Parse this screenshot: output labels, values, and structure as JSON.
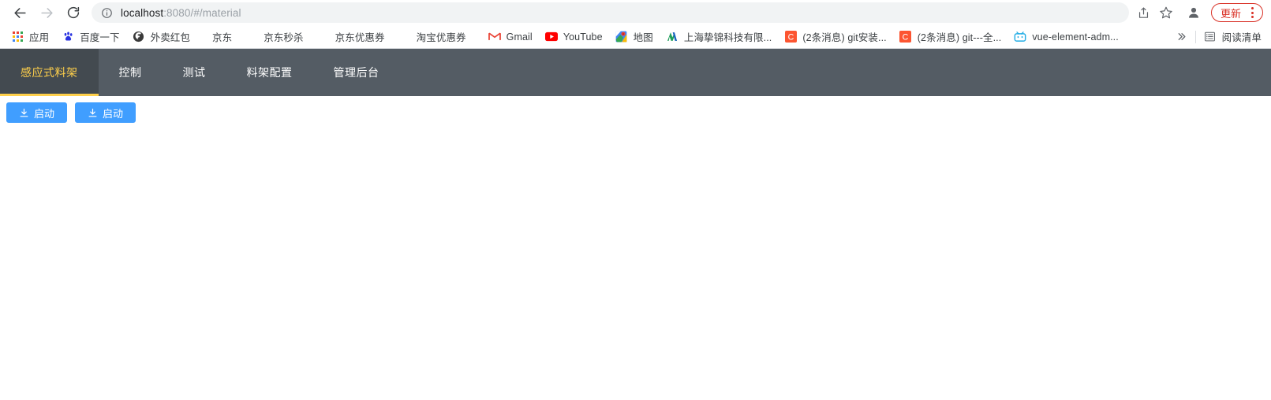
{
  "browser": {
    "nav": {
      "back_label": "Back",
      "forward_label": "Forward",
      "reload_label": "Reload"
    },
    "omnibox": {
      "site_info_icon": "info-circle-icon",
      "url_host": "localhost",
      "url_path": ":8080/#/material",
      "full_url": "localhost:8080/#/material",
      "share_icon": "share-icon",
      "bookmark_icon": "star-icon"
    },
    "profile": {
      "icon": "person-avatar-icon"
    },
    "update": {
      "label": "更新",
      "color": "#d93025",
      "menu_icon": "kebab-menu-icon"
    },
    "bookmarks": [
      {
        "label": "应用",
        "icon": "google-apps-grid-icon"
      },
      {
        "label": "百度一下",
        "icon": "baidu-paw-icon"
      },
      {
        "label": "外卖红包",
        "icon": "globe-dark-icon"
      },
      {
        "label": "京东",
        "icon": "none"
      },
      {
        "label": "京东秒杀",
        "icon": "none"
      },
      {
        "label": "京东优惠券",
        "icon": "none"
      },
      {
        "label": "淘宝优惠券",
        "icon": "none"
      },
      {
        "label": "Gmail",
        "icon": "gmail-icon"
      },
      {
        "label": "YouTube",
        "icon": "youtube-icon"
      },
      {
        "label": "地图",
        "icon": "google-maps-icon"
      },
      {
        "label": "上海挚锦科技有限...",
        "icon": "n-logo-icon"
      },
      {
        "label": "(2条消息) git安装...",
        "icon": "csdn-icon"
      },
      {
        "label": "(2条消息) git---全...",
        "icon": "csdn-icon"
      },
      {
        "label": "vue-element-adm...",
        "icon": "bilibili-tv-icon"
      }
    ],
    "overflow": {
      "icon": "double-chevron-right-icon",
      "label": "»"
    },
    "reading_list": {
      "label": "阅读清单",
      "icon": "reading-list-icon"
    }
  },
  "app": {
    "nav_bg": "#545c64",
    "active_color": "#ffd04b",
    "nav_items": [
      {
        "label": "感应式料架",
        "active": true
      },
      {
        "label": "控制",
        "active": false
      },
      {
        "label": "测试",
        "active": false
      },
      {
        "label": "料架配置",
        "active": false
      },
      {
        "label": "管理后台",
        "active": false
      }
    ],
    "buttons": [
      {
        "label": "启动",
        "icon": "download-icon",
        "color": "#409eff"
      },
      {
        "label": "启动",
        "icon": "download-icon",
        "color": "#409eff"
      }
    ]
  }
}
